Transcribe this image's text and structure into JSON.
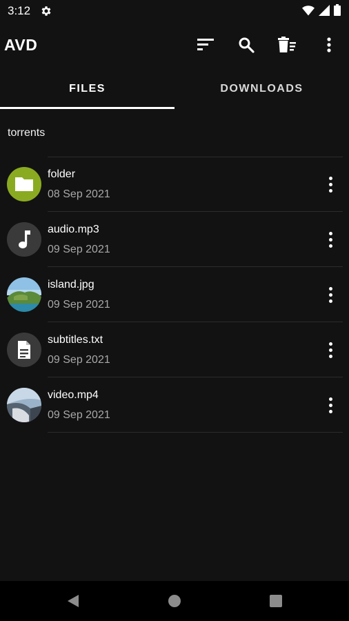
{
  "status_bar": {
    "time": "3:12",
    "icons": [
      "settings-gear-icon",
      "wifi-icon",
      "signal-icon",
      "battery-icon"
    ]
  },
  "app_bar": {
    "title": "AVD",
    "actions": [
      "sort-icon",
      "search-icon",
      "delete-list-icon",
      "more-vert-icon"
    ]
  },
  "tabs": [
    {
      "label": "FILES",
      "selected": true
    },
    {
      "label": "DOWNLOADS",
      "selected": false
    }
  ],
  "path": "torrents",
  "files": [
    {
      "name": "folder",
      "date": "08 Sep 2021",
      "icon": "folder-icon",
      "color": "#8aab21"
    },
    {
      "name": "audio.mp3",
      "date": "09 Sep 2021",
      "icon": "music-note-icon"
    },
    {
      "name": "island.jpg",
      "date": "09 Sep 2021",
      "icon": "island-thumbnail"
    },
    {
      "name": "subtitles.txt",
      "date": "09 Sep 2021",
      "icon": "document-icon"
    },
    {
      "name": "video.mp4",
      "date": "09 Sep 2021",
      "icon": "video-thumbnail"
    }
  ],
  "nav_bar": {
    "buttons": [
      "back-icon",
      "home-icon",
      "recents-icon"
    ]
  },
  "colors": {
    "background": "#121212",
    "accent_folder": "#8aab21",
    "secondary_text": "#a9a9a9"
  }
}
